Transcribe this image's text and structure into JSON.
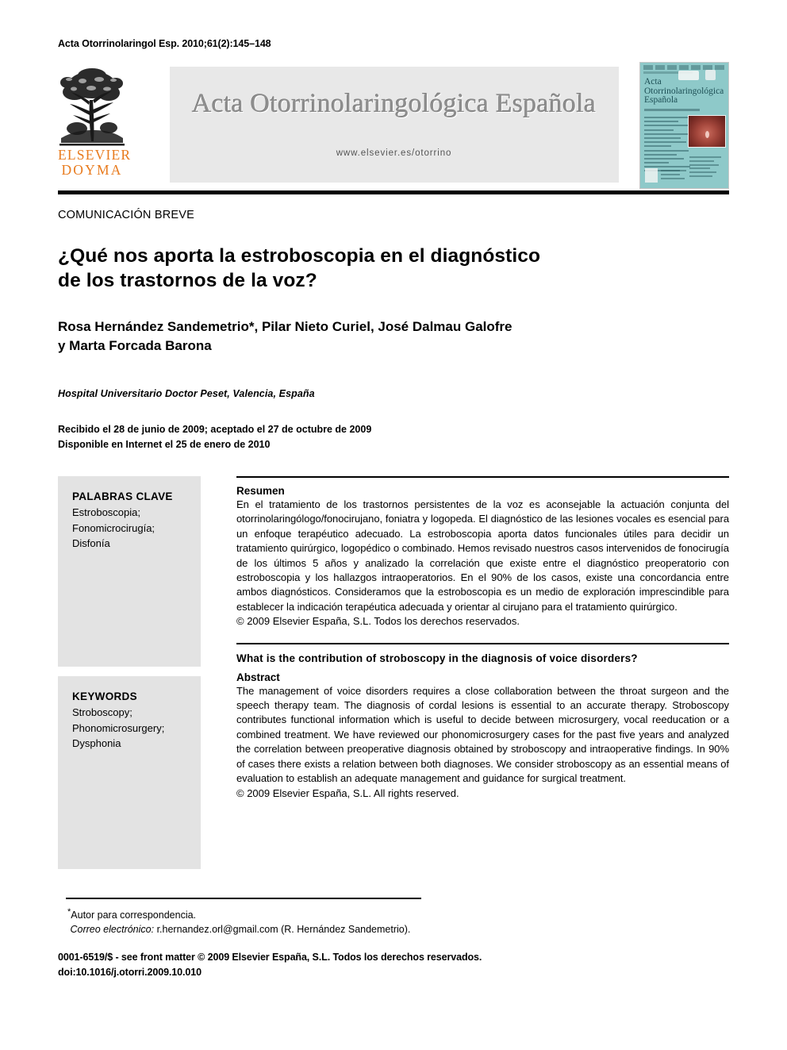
{
  "running_head": "Acta Otorrinolaringol Esp. 2010;61(2):145–148",
  "masthead": {
    "publisher_line1": "ELSEVIER",
    "publisher_line2": "DOYMA",
    "journal_title": "Acta Otorrinolaringológica Española",
    "journal_url": "www.elsevier.es/otorrino",
    "cover_title": "Acta Otorrinolaringológica Española"
  },
  "article": {
    "type": "COMUNICACIÓN BREVE",
    "title_line1": "¿Qué nos aporta la estroboscopia en el diagnóstico",
    "title_line2": "de los trastornos de la voz?",
    "authors_line1": "Rosa Hernández Sandemetrio*, Pilar Nieto Curiel, José Dalmau Galofre",
    "authors_line2": " y Marta Forcada Barona",
    "author_star": "*",
    "affiliation": "Hospital Universitario Doctor Peset, Valencia, España",
    "received": "Recibido el 28 de junio de 2009; aceptado el 27 de octubre de 2009",
    "available": "Disponible en Internet el 25 de enero de 2010"
  },
  "spanish": {
    "keywords_heading": "PALABRAS CLAVE",
    "keywords": "Estroboscopia;\nFonomicrocirugía;\nDisfonía",
    "abstract_heading": "Resumen",
    "abstract_body": "En el tratamiento de los trastornos persistentes de la voz es aconsejable la actuación conjunta del otorrinolaringólogo/fonocirujano, foniatra y logopeda. El diagnóstico de las lesiones vocales es esencial para un enfoque terapéutico adecuado. La estroboscopia aporta datos funcionales útiles para decidir un tratamiento quirúrgico, logopédico o combinado. Hemos revisado nuestros casos intervenidos de fonocirugía de los últimos 5 años y analizado la correlación que existe entre el diagnóstico preoperatorio con estroboscopia y los hallazgos intraoperatorios. En el 90% de los casos, existe una concordancia entre ambos diagnósticos. Consideramos que la estroboscopia es un medio de exploración imprescindible para establecer la indicación terapéutica adecuada y orientar al cirujano para el tratamiento quirúrgico.",
    "copyright": "© 2009 Elsevier España, S.L. Todos los derechos reservados."
  },
  "english": {
    "keywords_heading": "KEYWORDS",
    "keywords": "Stroboscopy;\nPhonomicrosurgery;\nDysphonia",
    "title": "What is the contribution of stroboscopy in the diagnosis of voice disorders?",
    "abstract_heading": "Abstract",
    "abstract_body": "The management of voice disorders requires a close collaboration between the throat surgeon and the speech therapy team. The diagnosis of cordal lesions is essential to an accurate therapy. Stroboscopy contributes functional information which is useful to decide between microsurgery, vocal reeducation or a combined treatment. We have reviewed our phonomicrosurgery cases for the past five years and analyzed the correlation between preoperative diagnosis obtained by stroboscopy and intraoperative findings. In 90% of cases there exists a relation between both diagnoses. We consider stroboscopy as an essential means of evaluation to establish an adequate management and guidance for surgical treatment.",
    "copyright": "© 2009 Elsevier España, S.L. All rights reserved."
  },
  "footer": {
    "corresponding_star": "*",
    "corresponding_label": "Autor para correspondencia.",
    "email_label": "Correo electrónico:",
    "email_value": "r.hernandez.orl@gmail.com",
    "email_owner": "(R. Hernández Sandemetrio).",
    "issn_line": "0001-6519/$ - see front matter © 2009 Elsevier España, S.L. Todos los derechos reservados.",
    "doi_line": "doi:10.1016/j.otorri.2009.10.010"
  },
  "colors": {
    "elsevier_orange": "#E87B1E",
    "banner_gray": "#e8e8e8",
    "keyword_panel_gray": "#e3e3e3",
    "cover_teal": "#8ec9c9"
  }
}
